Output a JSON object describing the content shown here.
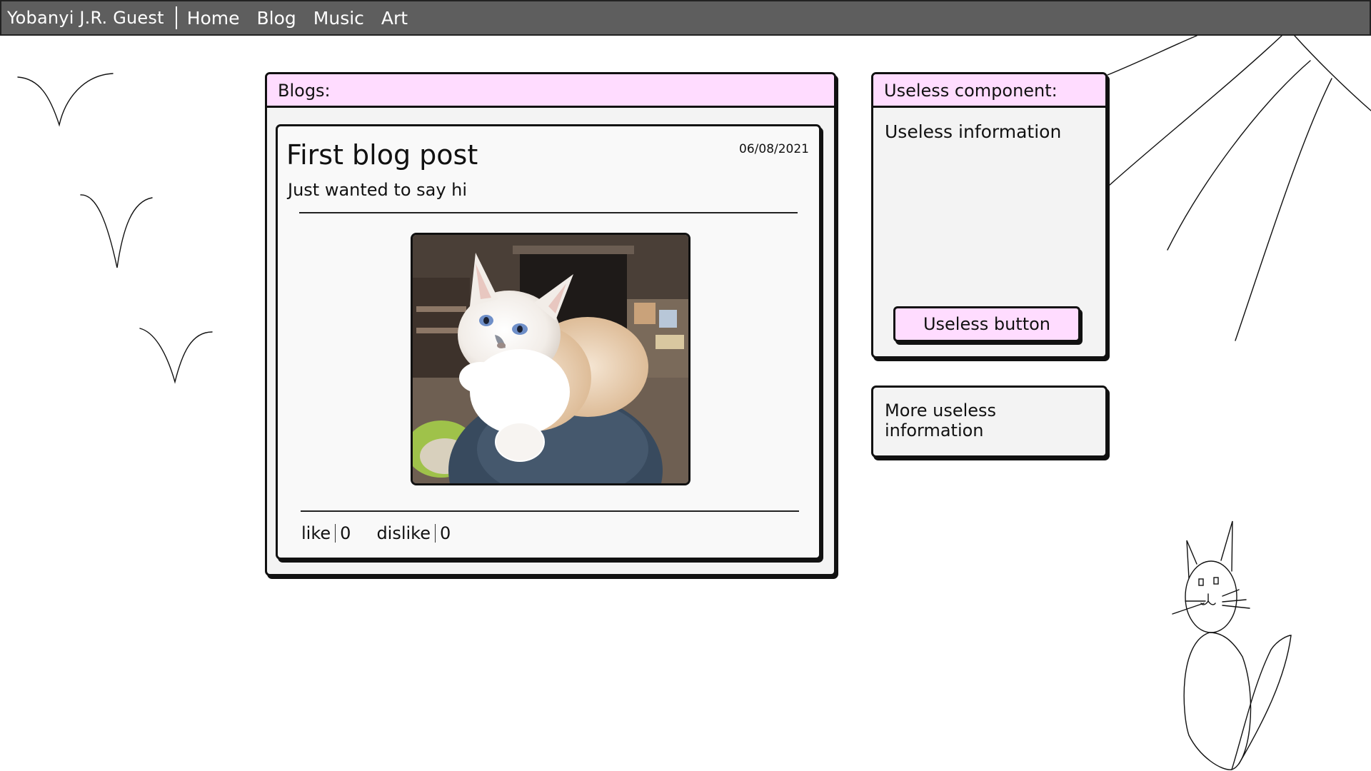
{
  "nav": {
    "brand": "Yobanyi J.R. Guest",
    "links": [
      "Home",
      "Blog",
      "Music",
      "Art"
    ]
  },
  "blogs": {
    "header": "Blogs:",
    "post": {
      "title": "First blog post",
      "date": "06/08/2021",
      "subtitle": "Just wanted to say hi",
      "image_icon": "kitten-photo",
      "like_label": "like",
      "like_count": "0",
      "dislike_label": "dislike",
      "dislike_count": "0"
    }
  },
  "useless": {
    "header": "Useless component:",
    "info": "Useless information",
    "button_label": "Useless button"
  },
  "more": {
    "text": "More useless information"
  },
  "colors": {
    "nav_bg": "#5e5e5e",
    "accent_pink": "#ffdcff",
    "card_bg": "#f3f3f3"
  },
  "decorations": [
    "bird-doodle",
    "bird-doodle",
    "bird-doodle",
    "sun-rays-doodle",
    "cat-doodle"
  ]
}
